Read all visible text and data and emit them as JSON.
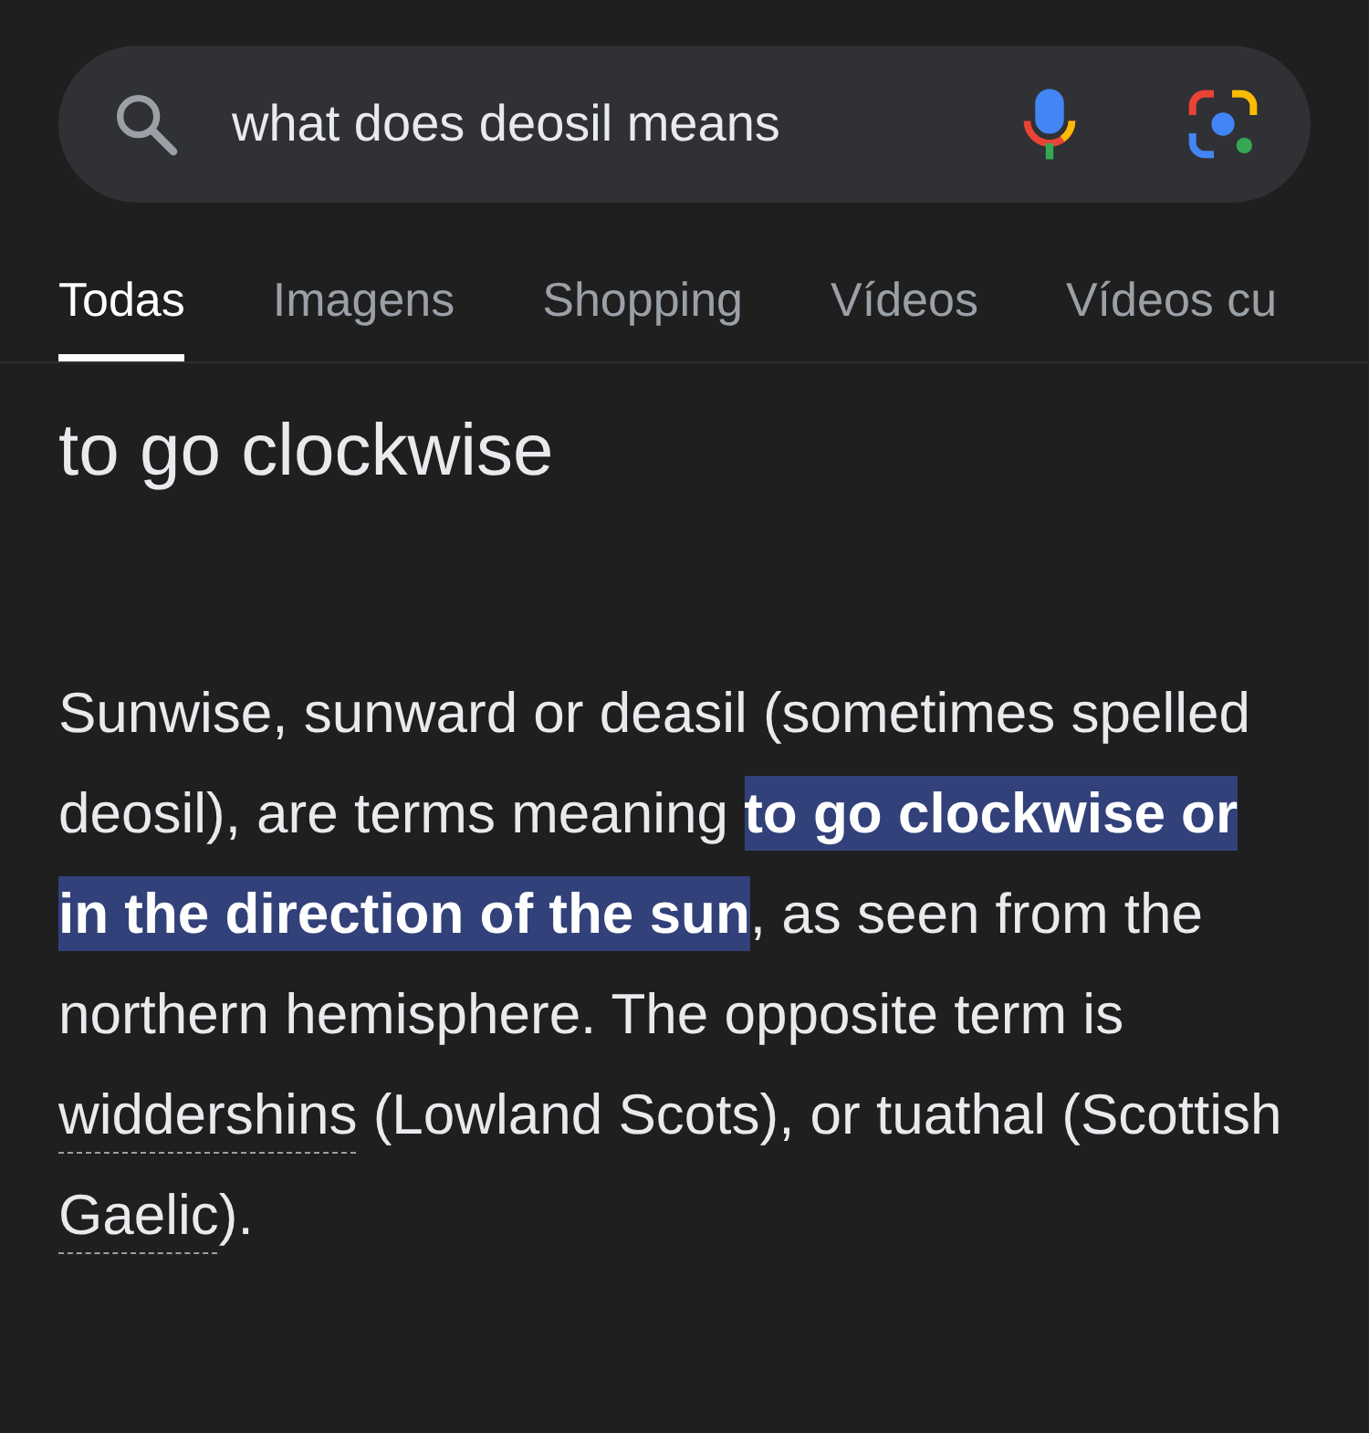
{
  "search": {
    "value": "what does deosil means"
  },
  "tabs": [
    {
      "label": "Todas",
      "selected": true
    },
    {
      "label": "Imagens",
      "selected": false
    },
    {
      "label": "Shopping",
      "selected": false
    },
    {
      "label": "Vídeos",
      "selected": false
    },
    {
      "label": "Vídeos cu",
      "selected": false
    }
  ],
  "answer": {
    "title": "to go clockwise",
    "paragraph": [
      {
        "kind": "text",
        "text": "Sunwise, sunward or deasil (sometimes spelled deosil), are terms meaning "
      },
      {
        "kind": "highlight",
        "text": "to go clockwise or in the direction of the sun"
      },
      {
        "kind": "text",
        "text": ", as seen from the northern hemisphere. The opposite term is "
      },
      {
        "kind": "link",
        "text": "widdershins"
      },
      {
        "kind": "text",
        "text": " (Lowland Scots), or tuathal (Scottish "
      },
      {
        "kind": "link",
        "text": "Gaelic"
      },
      {
        "kind": "text",
        "text": ")."
      }
    ]
  }
}
